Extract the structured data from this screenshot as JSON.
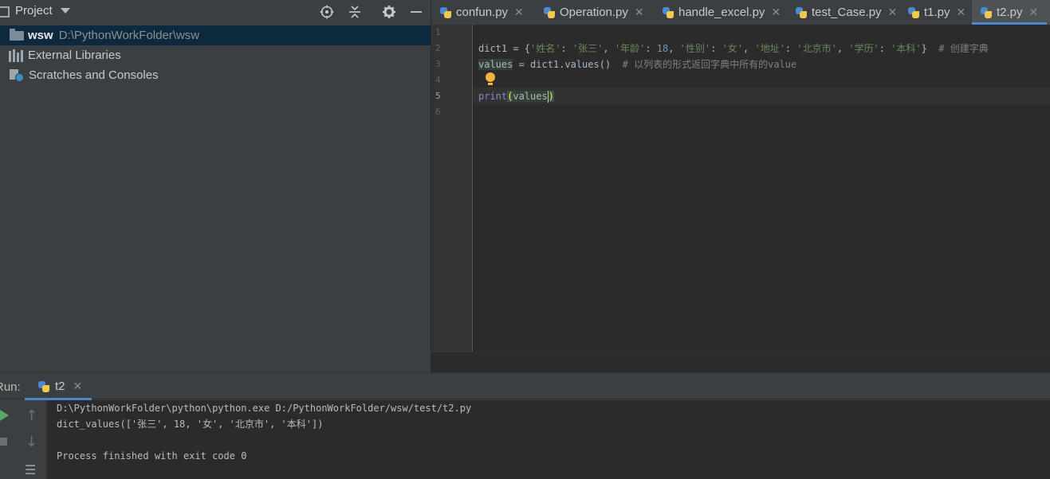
{
  "project_panel": {
    "title": "Project",
    "tree": {
      "root_name": "wsw",
      "root_path": "D:\\PythonWorkFolder\\wsw",
      "external_libraries": "External Libraries",
      "scratches": "Scratches and Consoles"
    }
  },
  "tabs": [
    {
      "label": "confun.py",
      "icon": "python-file-icon"
    },
    {
      "label": "Operation.py",
      "icon": "python-file-icon"
    },
    {
      "label": "handle_excel.py",
      "icon": "python-file-icon"
    },
    {
      "label": "test_Case.py",
      "icon": "python-file-icon"
    },
    {
      "label": "t1.py",
      "icon": "python-file-icon"
    },
    {
      "label": "t2.py",
      "icon": "python-file-icon",
      "active": true
    }
  ],
  "close_glyph": "✕",
  "editor": {
    "line_numbers": [
      "1",
      "2",
      "3",
      "4",
      "5",
      "6"
    ],
    "current_line": "5",
    "line2": {
      "p1": "dict1 = {",
      "s1": "'姓名'",
      "c1": ": ",
      "s2": "'张三'",
      "c2": ", ",
      "s3": "'年龄'",
      "c3": ": ",
      "n1": "18",
      "c4": ", ",
      "s4": "'性别'",
      "c5": ": ",
      "s5": "'女'",
      "c6": ", ",
      "s6": "'地址'",
      "c7": ": ",
      "s7": "'北京市'",
      "c8": ", ",
      "s8": "'学历'",
      "c9": ": ",
      "s9": "'本科'",
      "p2": "}  ",
      "comment": "# 创建字典"
    },
    "line3": {
      "var": "values",
      "rest": " = dict1.values()  ",
      "comment": "# 以列表的形式返回字典中所有的value"
    },
    "line5": {
      "fn": "print",
      "open": "(",
      "arg": "values",
      "close": ")"
    }
  },
  "run_panel": {
    "label": "Run:",
    "tab_label": "t2",
    "console_lines": [
      "D:\\PythonWorkFolder\\python\\python.exe D:/PythonWorkFolder/wsw/test/t2.py",
      "dict_values(['张三', 18, '女', '北京市', '本科'])",
      "",
      "Process finished with exit code 0"
    ]
  },
  "colors": {
    "accent": "#4a88c7",
    "run_green": "#59a869",
    "selection": "#0d293e"
  }
}
